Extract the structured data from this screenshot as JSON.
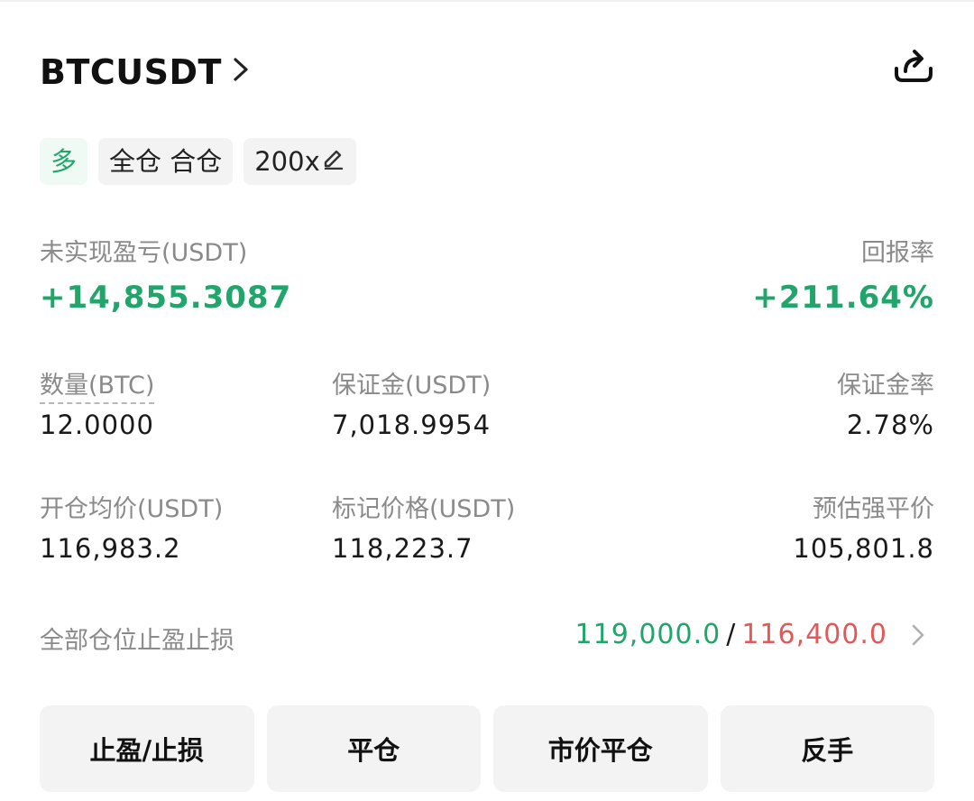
{
  "header": {
    "symbol": "BTCUSDT"
  },
  "tags": {
    "side": "多",
    "margin_mode": "全仓 合仓",
    "leverage": "200x"
  },
  "pnl": {
    "unrealized_label": "未实现盈亏(USDT)",
    "unrealized_value": "+14,855.3087",
    "roe_label": "回报率",
    "roe_value": "+211.64%"
  },
  "stats": {
    "qty_label": "数量(BTC)",
    "qty_value": "12.0000",
    "margin_label": "保证金(USDT)",
    "margin_value": "7,018.9954",
    "margin_ratio_label": "保证金率",
    "margin_ratio_value": "2.78%",
    "entry_label": "开仓均价(USDT)",
    "entry_value": "116,983.2",
    "mark_label": "标记价格(USDT)",
    "mark_value": "118,223.7",
    "liq_label": "预估强平价",
    "liq_value": "105,801.8"
  },
  "tpsl": {
    "label": "全部仓位止盈止损",
    "take_profit": "119,000.0",
    "separator": "/",
    "stop_loss": "116,400.0"
  },
  "buttons": {
    "tpsl": "止盈/止损",
    "close": "平仓",
    "market_close": "市价平仓",
    "reverse": "反手"
  },
  "colors": {
    "green": "#22a56b",
    "red": "#e05a5a",
    "label_gray": "#8a8a8a",
    "button_bg": "#f3f3f3"
  },
  "icons": {
    "header_chevron": "chevron-right-icon",
    "share": "share-icon",
    "leverage_edit": "pencil-icon",
    "tpsl_chevron": "chevron-right-icon"
  }
}
